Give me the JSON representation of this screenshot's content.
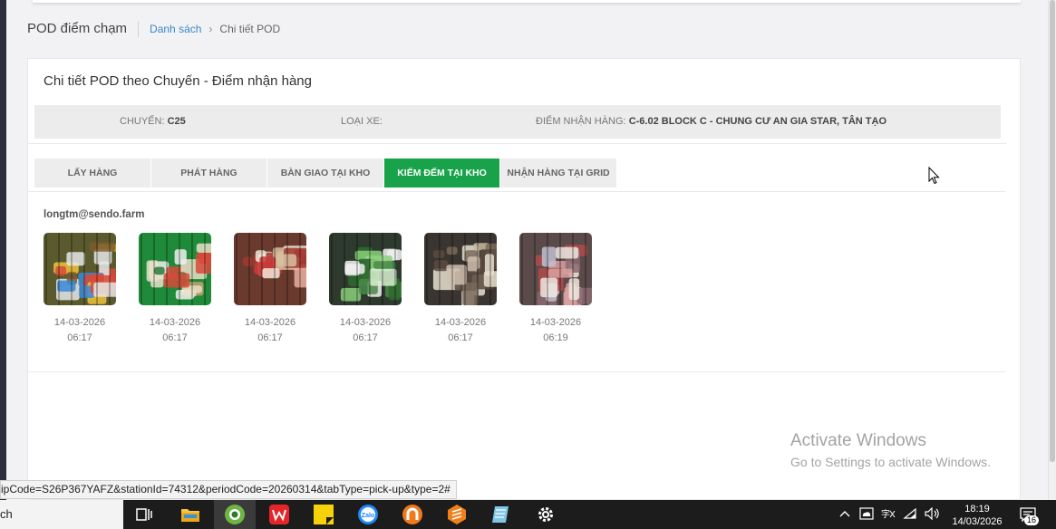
{
  "header": {
    "title": "POD điểm chạm",
    "breadcrumb": {
      "link": "Danh sách",
      "separator": "›",
      "current": "Chi tiết POD"
    }
  },
  "card": {
    "title": "Chi tiết POD theo Chuyến - Điểm nhận hàng",
    "info": {
      "trip_label": "CHUYẾN:",
      "trip_value": "C25",
      "vehicle_label": "LOẠI XE:",
      "vehicle_value": "",
      "point_label": "ĐIỂM NHẬN HÀNG:",
      "point_value": "C-6.02 BLOCK C - CHUNG CƯ AN GIA STAR, TÂN TẠO"
    },
    "tabs": [
      {
        "label": "LẤY HÀNG",
        "active": false
      },
      {
        "label": "PHÁT HÀNG",
        "active": false
      },
      {
        "label": "BÀN GIAO TẠI KHO",
        "active": false
      },
      {
        "label": "KIỂM ĐẾM TẠI KHO",
        "active": true
      },
      {
        "label": "NHẬN HÀNG TẠI GRID",
        "active": false
      }
    ],
    "user_email": "longtm@sendo.farm",
    "photos": [
      {
        "date": "14-03-2026",
        "time": "06:17",
        "tone": "#5a5a2e"
      },
      {
        "date": "14-03-2026",
        "time": "06:17",
        "tone": "#1f8a3a"
      },
      {
        "date": "14-03-2026",
        "time": "06:17",
        "tone": "#6a3a2e"
      },
      {
        "date": "14-03-2026",
        "time": "06:17",
        "tone": "#2e3a2e"
      },
      {
        "date": "14-03-2026",
        "time": "06:17",
        "tone": "#3a3530"
      },
      {
        "date": "14-03-2026",
        "time": "06:19",
        "tone": "#5a4a4a"
      }
    ]
  },
  "watermark": {
    "title": "Activate Windows",
    "subtitle": "Go to Settings to activate Windows."
  },
  "status_url": "ipCode=S26P367YAFZ&stationId=74312&periodCode=20260314&tabType=pick-up&type=2#",
  "taskbar": {
    "search_text": "ch",
    "time": "18:19",
    "date": "14/03/2026",
    "notification_count": "16"
  },
  "colors": {
    "accent_green": "#18a34a",
    "link_blue": "#3a87c8"
  }
}
